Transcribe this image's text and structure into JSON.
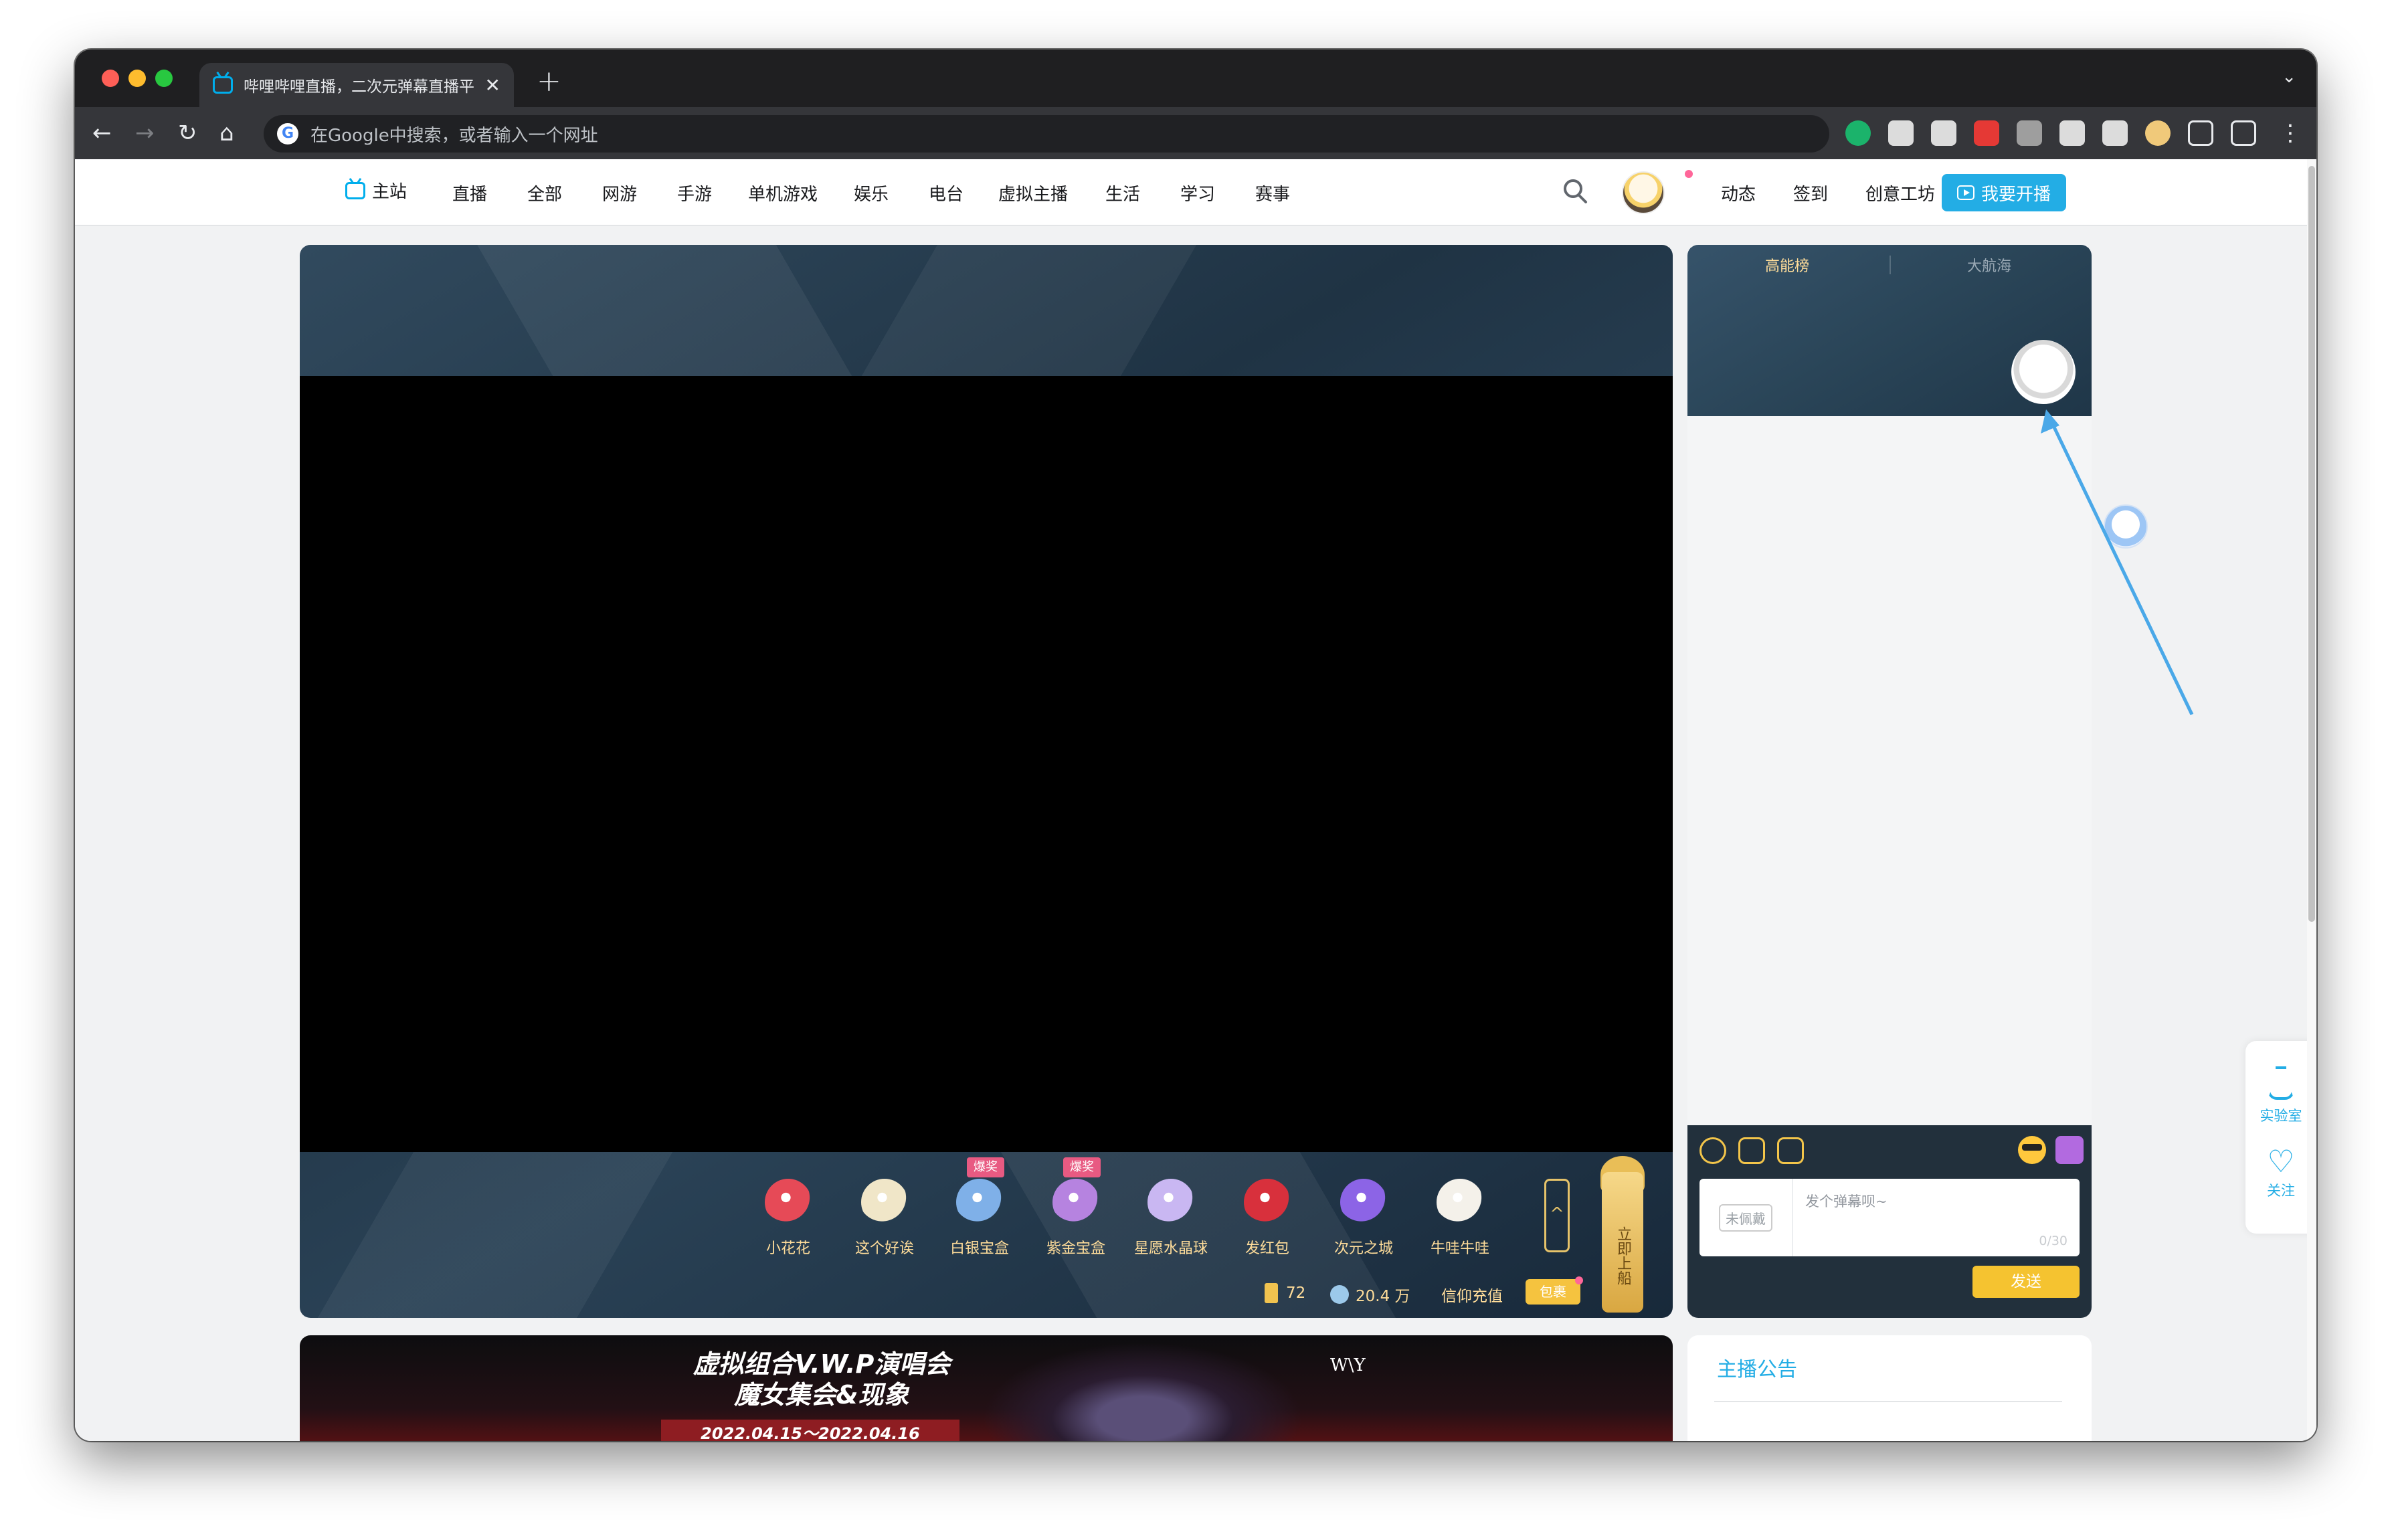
{
  "browser": {
    "tab_title": "哔哩哔哩直播，二次元弹幕直播平台",
    "tab_close": "✕",
    "new_tab": "+",
    "tab_menu": "⌄",
    "back": "←",
    "forward": "→",
    "reload": "↻",
    "home": "⌂",
    "omnibox_placeholder": "在Google中搜索，或者输入一个网址",
    "google_letter": "G",
    "menu_dots": "⋮",
    "ext_colors": [
      "#1bb36b",
      "#dcdcdc",
      "#dcdcdc",
      "#e53935",
      "#9e9e9e",
      "#dcdcdc",
      "#dcdcdc",
      "#f0c97a"
    ]
  },
  "nav": {
    "home": "主站",
    "items": [
      "直播",
      "全部",
      "网游",
      "手游",
      "单机游戏",
      "娱乐",
      "电台",
      "虚拟主播",
      "生活",
      "学习",
      "赛事"
    ],
    "right": [
      "动态",
      "签到",
      "创意工坊"
    ],
    "go_live": "我要开播"
  },
  "gifts": [
    {
      "label": "小花花",
      "color": "#e64a57",
      "badge": ""
    },
    {
      "label": "这个好诶",
      "color": "#f0e6c8",
      "badge": ""
    },
    {
      "label": "白银宝盒",
      "color": "#7fb0e8",
      "badge": "爆奖"
    },
    {
      "label": "紫金宝盒",
      "color": "#b683e0",
      "badge": "爆奖"
    },
    {
      "label": "星愿水晶球",
      "color": "#c9b7f2",
      "badge": ""
    },
    {
      "label": "发红包",
      "color": "#d8303c",
      "badge": ""
    },
    {
      "label": "次元之城",
      "color": "#8c64e6",
      "badge": ""
    },
    {
      "label": "牛哇牛哇",
      "color": "#f4f1ea",
      "badge": ""
    }
  ],
  "player": {
    "expand": "^",
    "board_btn": "立即上船",
    "battery": "72",
    "silver": "20.4 万",
    "recharge": "信仰充值",
    "package": "包裹"
  },
  "rank": {
    "tabs": [
      "高能榜",
      "大航海"
    ]
  },
  "chat": {
    "medal": "未佩戴",
    "placeholder": "发个弹幕呗~",
    "count": "0/30",
    "send": "发送"
  },
  "banner": {
    "line1": "虚拟组合V.W.P演唱会",
    "line2": "魔女集会&现象",
    "date": "2022.04.15～2022.04.16",
    "logo": "W\\Y"
  },
  "notice": {
    "title": "主播公告"
  },
  "side_widget": {
    "lab": "实验室",
    "follow": "关注"
  },
  "colors": {
    "accent": "#23ade5",
    "gold": "#ffdd9a",
    "annotation": "#4aa8e8"
  }
}
